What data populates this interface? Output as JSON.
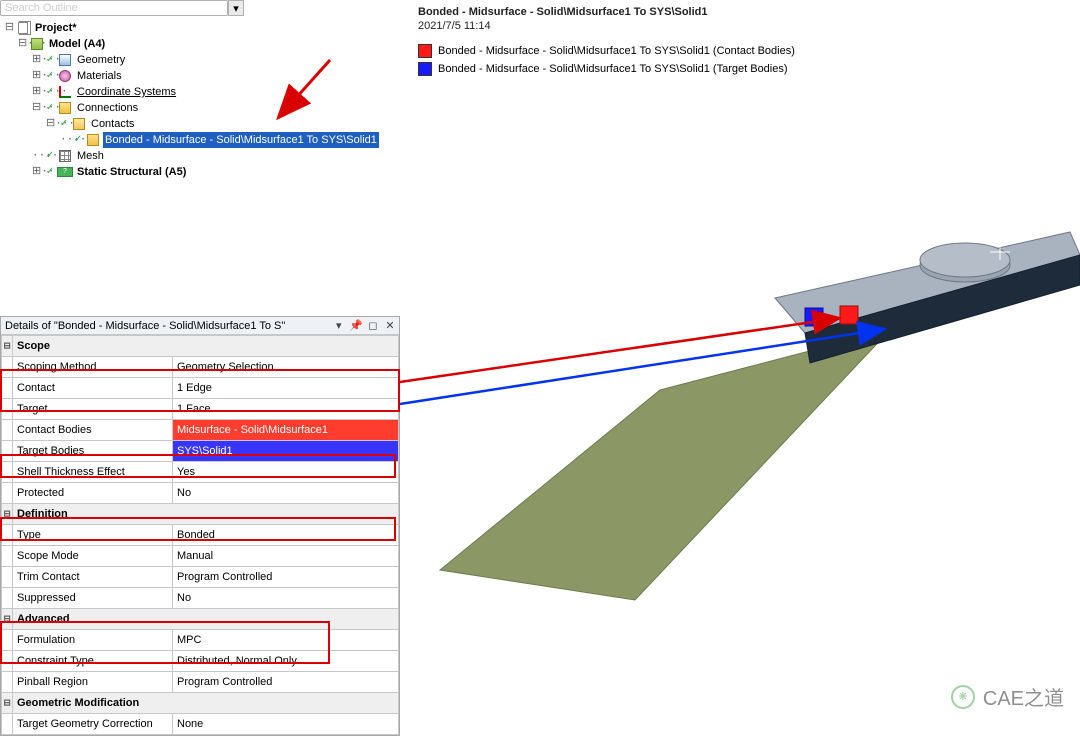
{
  "search": {
    "placeholder": "Search Outline"
  },
  "tree": {
    "project": "Project*",
    "model": "Model (A4)",
    "geometry": "Geometry",
    "materials": "Materials",
    "csys": "Coordinate Systems",
    "connections": "Connections",
    "contacts": "Contacts",
    "bonded": "Bonded - Midsurface - Solid\\Midsurface1 To SYS\\Solid1",
    "mesh": "Mesh",
    "static": "Static Structural (A5)"
  },
  "graphics": {
    "title": "Bonded - Midsurface - Solid\\Midsurface1 To SYS\\Solid1",
    "timestamp": "2021/7/5 11:14",
    "legend": {
      "contact": "Bonded - Midsurface - Solid\\Midsurface1 To SYS\\Solid1 (Contact Bodies)",
      "target": "Bonded - Midsurface - Solid\\Midsurface1 To SYS\\Solid1 (Target Bodies)"
    }
  },
  "details": {
    "title": "Details of \"Bonded - Midsurface - Solid\\Midsurface1 To S\"",
    "groups": {
      "scope": "Scope",
      "definition": "Definition",
      "advanced": "Advanced",
      "geommod": "Geometric Modification"
    },
    "rows": {
      "scoping_method": {
        "k": "Scoping Method",
        "v": "Geometry Selection"
      },
      "contact": {
        "k": "Contact",
        "v": "1 Edge"
      },
      "target": {
        "k": "Target",
        "v": "1 Face"
      },
      "contact_bodies": {
        "k": "Contact Bodies",
        "v": "Midsurface - Solid\\Midsurface1"
      },
      "target_bodies": {
        "k": "Target Bodies",
        "v": "SYS\\Solid1"
      },
      "shell_thickness": {
        "k": "Shell Thickness Effect",
        "v": "Yes"
      },
      "protected": {
        "k": "Protected",
        "v": "No"
      },
      "type": {
        "k": "Type",
        "v": "Bonded"
      },
      "scope_mode": {
        "k": "Scope Mode",
        "v": "Manual"
      },
      "trim_contact": {
        "k": "Trim Contact",
        "v": "Program Controlled"
      },
      "suppressed": {
        "k": "Suppressed",
        "v": "No"
      },
      "formulation": {
        "k": "Formulation",
        "v": "MPC"
      },
      "constraint_type": {
        "k": "Constraint Type",
        "v": "Distributed, Normal Only"
      },
      "pinball": {
        "k": "Pinball Region",
        "v": "Program Controlled"
      },
      "target_geom_corr": {
        "k": "Target Geometry Correction",
        "v": "None"
      }
    }
  },
  "watermark": {
    "text": "CAE之道"
  },
  "glyphs": {
    "minus": "⊟",
    "plus": "⊞",
    "pin": "▾ ⬓ ✕",
    "check": "✓"
  }
}
